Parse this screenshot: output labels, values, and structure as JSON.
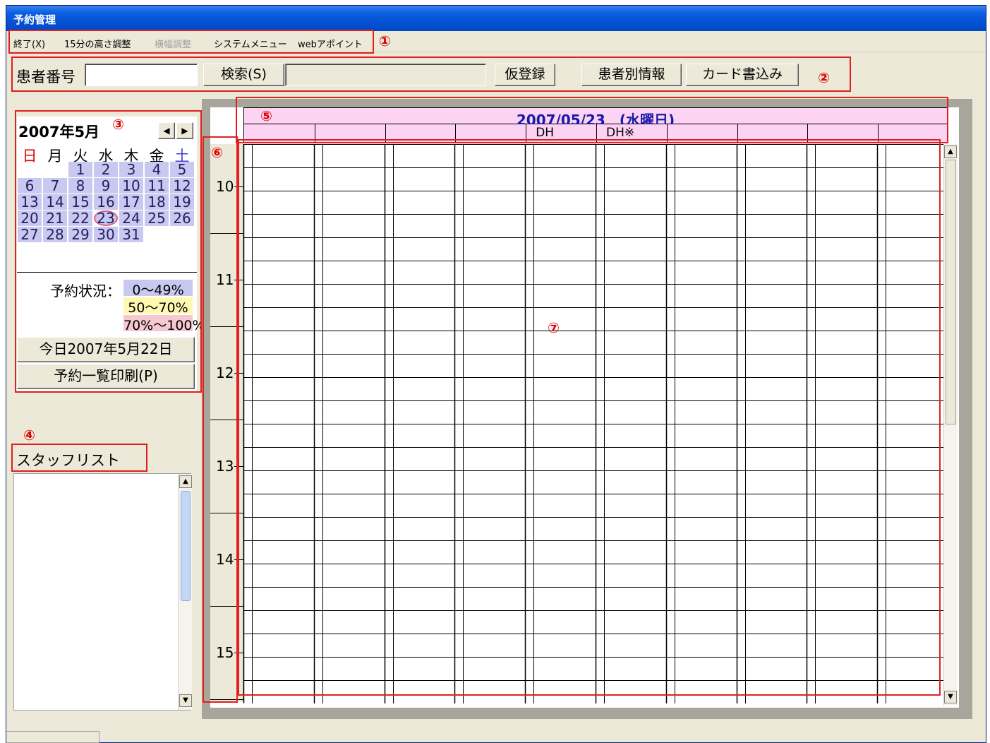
{
  "window": {
    "title": "予約管理"
  },
  "menu": [
    {
      "label": "終了(X)",
      "enabled": true
    },
    {
      "label": "15分の高さ調整",
      "enabled": true
    },
    {
      "label": "横幅調整",
      "enabled": false
    },
    {
      "label": "システムメニュー",
      "enabled": true
    },
    {
      "label": "webアポイント",
      "enabled": true
    }
  ],
  "markers": [
    "①",
    "②",
    "③",
    "④",
    "⑤",
    "⑥",
    "⑦"
  ],
  "toolbar": {
    "patient_number_label": "患者番号",
    "patient_number_value": "",
    "search_label": "検索(S)",
    "search_result": "",
    "provisional_label": "仮登録",
    "patient_info_label": "患者別情報",
    "card_write_label": "カード書込み"
  },
  "calendar": {
    "month_title": "2007年5月",
    "weekdays": [
      "日",
      "月",
      "火",
      "水",
      "木",
      "金",
      "土"
    ],
    "weekday_colors": {
      "sunday": "#e00000",
      "saturday": "#4040e0",
      "weekday": "#000000"
    },
    "rows": [
      [
        "",
        "",
        "1",
        "2",
        "3",
        "4",
        "5"
      ],
      [
        "6",
        "7",
        "8",
        "9",
        "10",
        "11",
        "12"
      ],
      [
        "13",
        "14",
        "15",
        "16",
        "17",
        "18",
        "19"
      ],
      [
        "20",
        "21",
        "22",
        "23",
        "24",
        "25",
        "26"
      ],
      [
        "27",
        "28",
        "29",
        "30",
        "31",
        "",
        ""
      ]
    ],
    "selected_day": "23",
    "status_label": "予約状況：",
    "legend": [
      {
        "text": "0〜49%",
        "color": "#c8c8f0"
      },
      {
        "text": "50〜70%",
        "color": "#fff8b0"
      },
      {
        "text": "70%〜100%",
        "color": "#f8c8d0"
      }
    ],
    "today_button": "今日2007年5月22日",
    "print_button": "予約一覧印刷(P)"
  },
  "staff": {
    "title": "スタッフリスト"
  },
  "schedule": {
    "date_header": "2007/05/23　(水曜日)",
    "columns": [
      "",
      "",
      "",
      "",
      "DH",
      "DH※",
      "",
      "",
      "",
      ""
    ],
    "hours": [
      "10",
      "11",
      "12",
      "13",
      "14",
      "15"
    ]
  }
}
